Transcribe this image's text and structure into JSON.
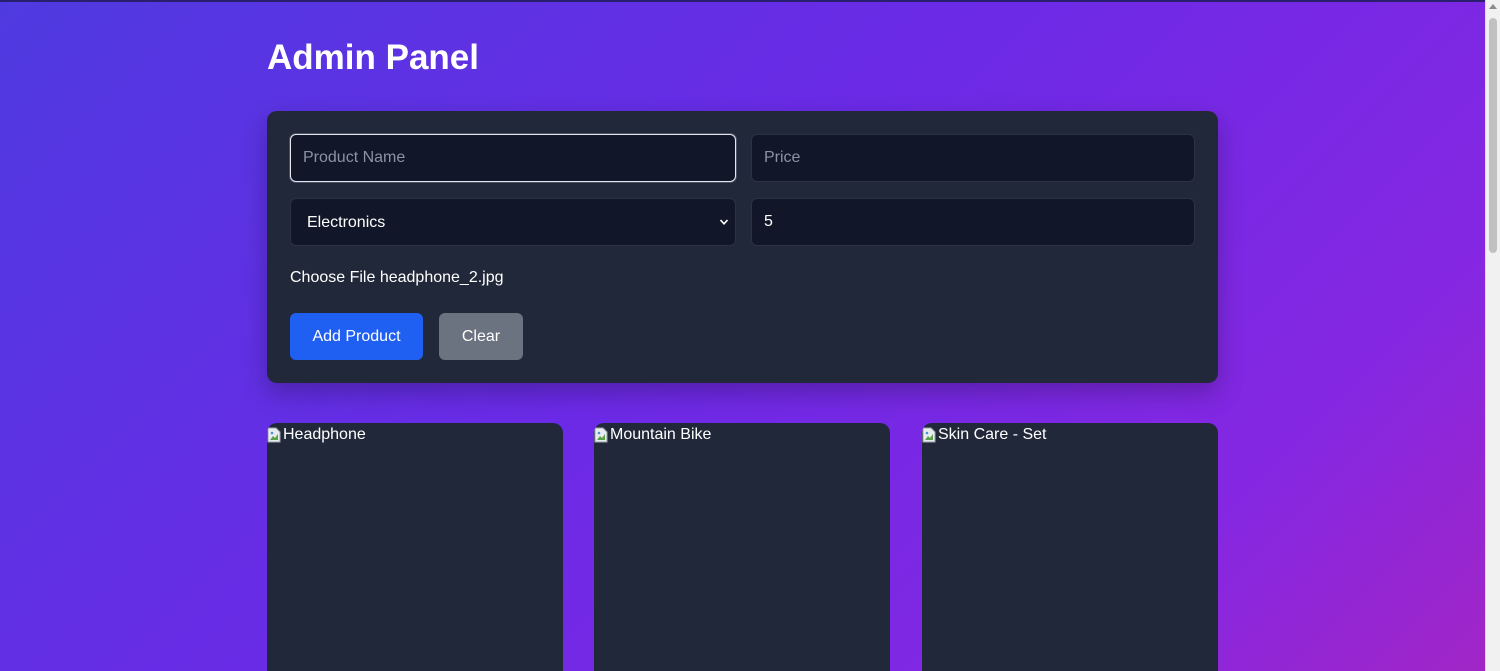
{
  "page": {
    "title": "Admin Panel"
  },
  "form": {
    "name_placeholder": "Product Name",
    "name_value": "",
    "price_placeholder": "Price",
    "price_value": "",
    "category_value": "Electronics",
    "rating_value": "5",
    "file_button_label": "Choose File",
    "file_name": "headphone_2.jpg",
    "add_label": "Add Product",
    "clear_label": "Clear"
  },
  "products": [
    {
      "alt": "Headphone"
    },
    {
      "alt": "Mountain Bike"
    },
    {
      "alt": "Skin Care - Set"
    }
  ],
  "colors": {
    "card_bg": "#212839",
    "input_bg": "#111728",
    "primary": "#1f5ff2",
    "secondary": "#6b7280"
  },
  "icons": {
    "broken_image": "broken-image-icon",
    "select_arrow": "chevron-down-icon"
  }
}
